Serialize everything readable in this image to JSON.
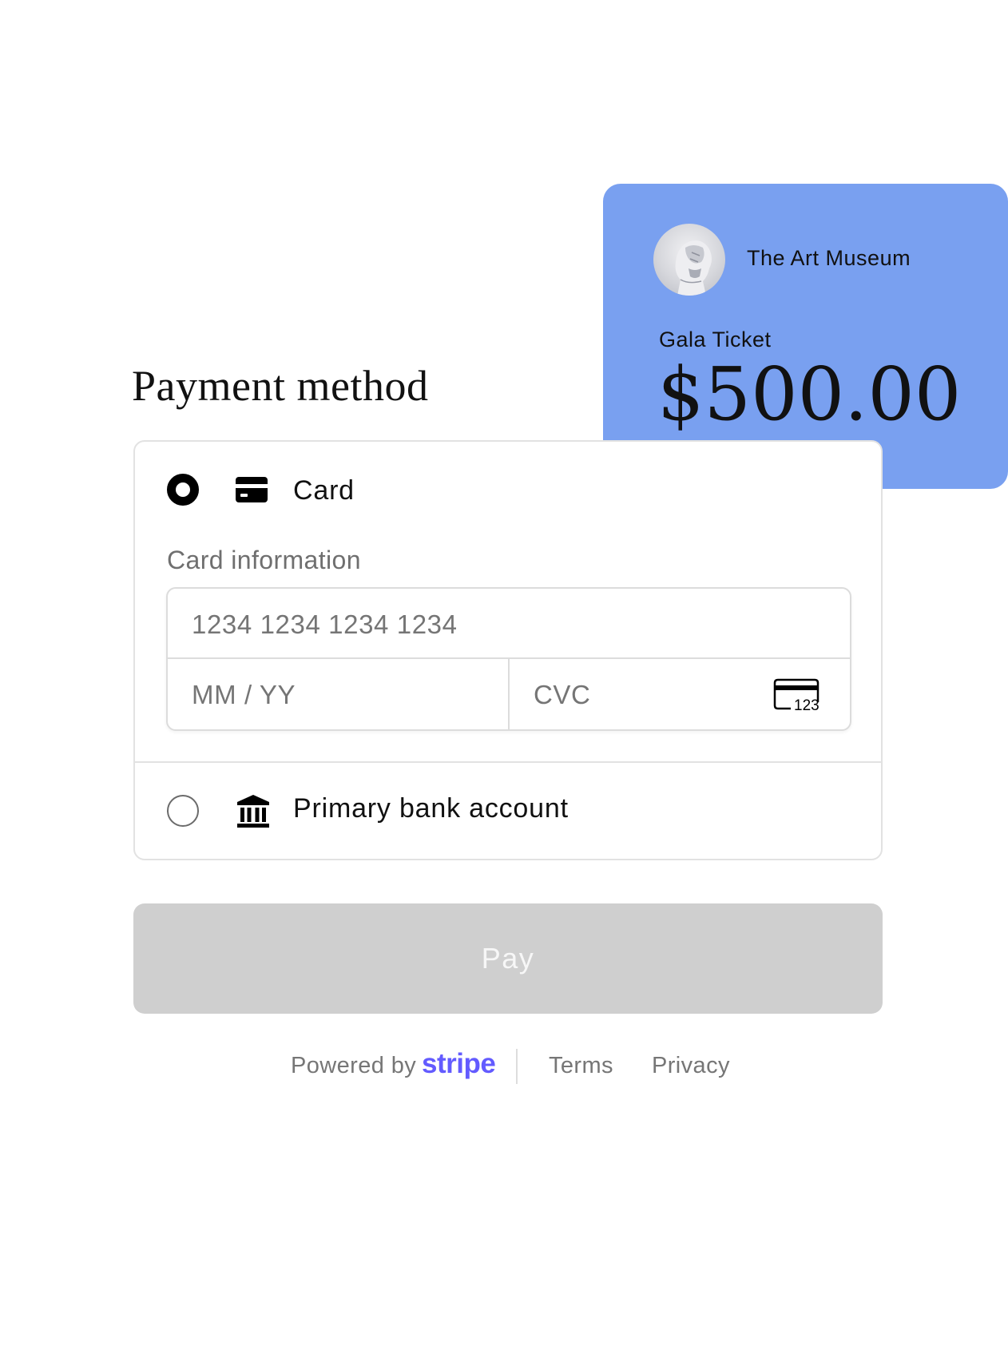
{
  "merchant": {
    "name": "The Art Museum",
    "logo_icon": "statue-head-avatar",
    "item": "Gala Ticket",
    "price": "$500.00",
    "card_color": "#79a0f0"
  },
  "payment": {
    "title": "Payment method",
    "methods": [
      {
        "label": "Card",
        "icon": "credit-card-icon",
        "selected": true
      },
      {
        "label": "Primary bank account",
        "icon": "bank-icon",
        "selected": false
      }
    ],
    "card_info_label": "Card information",
    "fields": {
      "card_number_placeholder": "1234 1234 1234 1234",
      "expiry_placeholder": "MM / YY",
      "cvc_placeholder": "CVC",
      "cvc_icon": "cvc-card-icon",
      "cvc_icon_text": "123"
    }
  },
  "pay_button": {
    "label": "Pay",
    "color": "#cfcfcf",
    "disabled": true
  },
  "footer": {
    "powered_by": "Powered by",
    "brand": "stripe",
    "brand_color": "#635bff",
    "terms": "Terms",
    "privacy": "Privacy"
  }
}
